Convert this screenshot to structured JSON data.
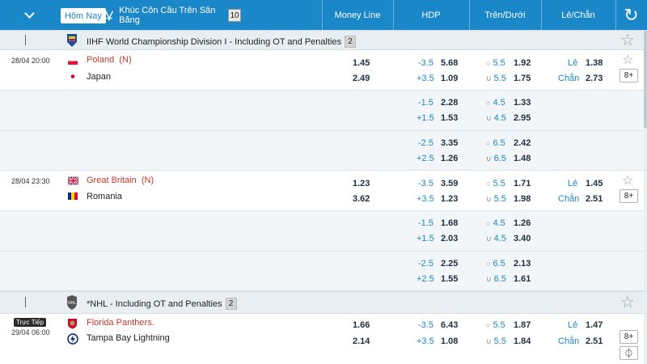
{
  "header": {
    "today_label": "Hôm Nay",
    "sport_label": "Khúc Côn Cầu Trên Sân Băng",
    "sport_count": "10",
    "col_moneyline": "Money Line",
    "col_hdp": "HDP",
    "col_overunder": "Trên/Dưới",
    "col_oddeven": "Lẻ/Chẵn"
  },
  "leagues": [
    {
      "name": "IIHF World Championship Division I - Including OT and Penalties",
      "count": "2",
      "matches": [
        {
          "time": "28/04 20:00",
          "home": "Poland",
          "home_tag": "(N)",
          "away": "Japan",
          "ml_home": "1.45",
          "ml_away": "2.49",
          "lines": [
            {
              "hdp_h": "-3.5",
              "hdp_h_odds": "5.68",
              "hdp_a": "+3.5",
              "hdp_a_odds": "1.09",
              "ou_o": "5.5",
              "ou_o_odds": "1.92",
              "ou_u": "5.5",
              "ou_u_odds": "1.75"
            },
            {
              "hdp_h": "-1.5",
              "hdp_h_odds": "2.28",
              "hdp_a": "+1.5",
              "hdp_a_odds": "1.53",
              "ou_o": "4.5",
              "ou_o_odds": "1.33",
              "ou_u": "4.5",
              "ou_u_odds": "2.95"
            },
            {
              "hdp_h": "-2.5",
              "hdp_h_odds": "3.35",
              "hdp_a": "+2.5",
              "hdp_a_odds": "1.26",
              "ou_o": "6.5",
              "ou_o_odds": "2.42",
              "ou_u": "6.5",
              "ou_u_odds": "1.48"
            }
          ],
          "odd_label": "Lẻ",
          "odd_odds": "1.38",
          "even_label": "Chẵn",
          "even_odds": "2.73",
          "more": "8+"
        },
        {
          "time": "28/04 23:30",
          "home": "Great Britain",
          "home_tag": "(N)",
          "away": "Romania",
          "ml_home": "1.23",
          "ml_away": "3.62",
          "lines": [
            {
              "hdp_h": "-3.5",
              "hdp_h_odds": "3.59",
              "hdp_a": "+3.5",
              "hdp_a_odds": "1.23",
              "ou_o": "5.5",
              "ou_o_odds": "1.71",
              "ou_u": "5.5",
              "ou_u_odds": "1.98"
            },
            {
              "hdp_h": "-1.5",
              "hdp_h_odds": "1.68",
              "hdp_a": "+1.5",
              "hdp_a_odds": "2.03",
              "ou_o": "4.5",
              "ou_o_odds": "1.26",
              "ou_u": "4.5",
              "ou_u_odds": "3.40"
            },
            {
              "hdp_h": "-2.5",
              "hdp_h_odds": "2.25",
              "hdp_a": "+2.5",
              "hdp_a_odds": "1.55",
              "ou_o": "6.5",
              "ou_o_odds": "2.13",
              "ou_u": "6.5",
              "ou_u_odds": "1.61"
            }
          ],
          "odd_label": "Lẻ",
          "odd_odds": "1.45",
          "even_label": "Chẵn",
          "even_odds": "2.51",
          "more": "8+"
        }
      ]
    },
    {
      "name": "*NHL - Including OT and Penalties",
      "count": "2",
      "matches": [
        {
          "live": "Trực Tiếp",
          "time": "29/04 06:00",
          "home": "Florida Panthers.",
          "away": "Tampa Bay Lightning",
          "ml_home": "1.66",
          "ml_away": "2.14",
          "lines": [
            {
              "hdp_h": "-3.5",
              "hdp_h_odds": "6.43",
              "hdp_a": "+3.5",
              "hdp_a_odds": "1.08",
              "ou_o": "5.5",
              "ou_o_odds": "1.87",
              "ou_u": "5.5",
              "ou_u_odds": "1.84"
            }
          ],
          "odd_label": "Lẻ",
          "odd_odds": "1.47",
          "even_label": "Chẵn",
          "even_odds": "2.51",
          "more": "8+"
        }
      ]
    }
  ],
  "icons": {
    "over_symbol": "○",
    "under_symbol": "∪",
    "star": "☆",
    "refresh": "↻",
    "stats": "⏀"
  },
  "colors": {
    "header_bg": "#1a87c9",
    "odds_blue": "#1a87c9",
    "home_red": "#c0392b"
  }
}
